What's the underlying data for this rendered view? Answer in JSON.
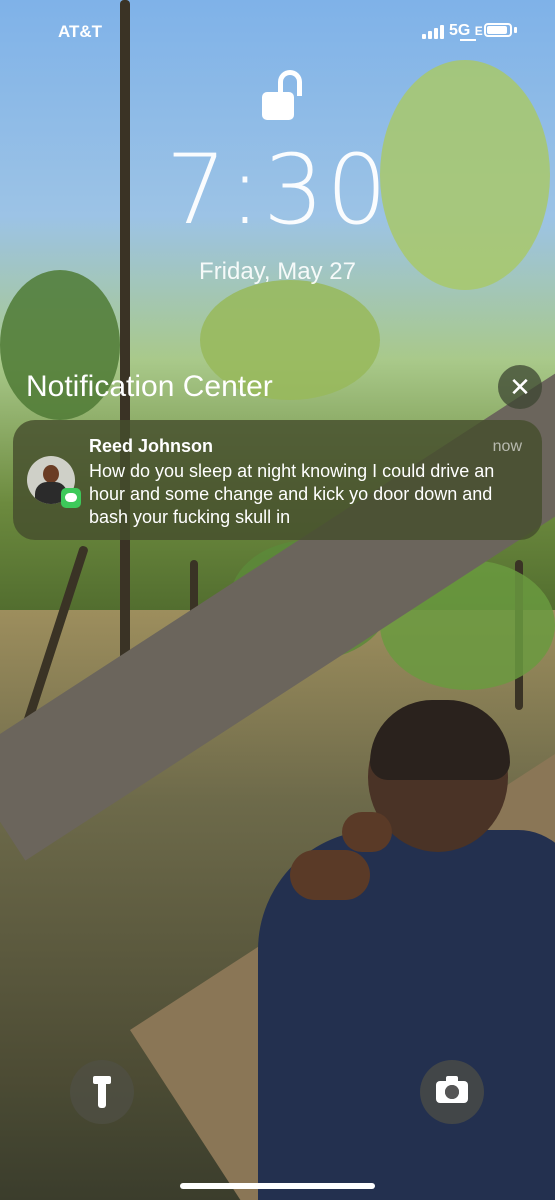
{
  "status_bar": {
    "carrier": "AT&T",
    "network": "5G E",
    "network_main": "5G",
    "network_sub": "E",
    "battery_level": 0.9
  },
  "lock_screen": {
    "time": "7:30",
    "date": "Friday, May 27",
    "lock_state": "unlocked"
  },
  "notification_center": {
    "title": "Notification Center",
    "clear_icon": "close-icon"
  },
  "notification": {
    "app_icon": "messages-icon",
    "sender": "Reed Johnson",
    "time": "now",
    "message": "How do you sleep at night knowing I could drive an hour and some change and kick yo door down and bash your fucking skull in"
  },
  "quick_actions": {
    "left_icon": "flashlight-icon",
    "right_icon": "camera-icon"
  }
}
